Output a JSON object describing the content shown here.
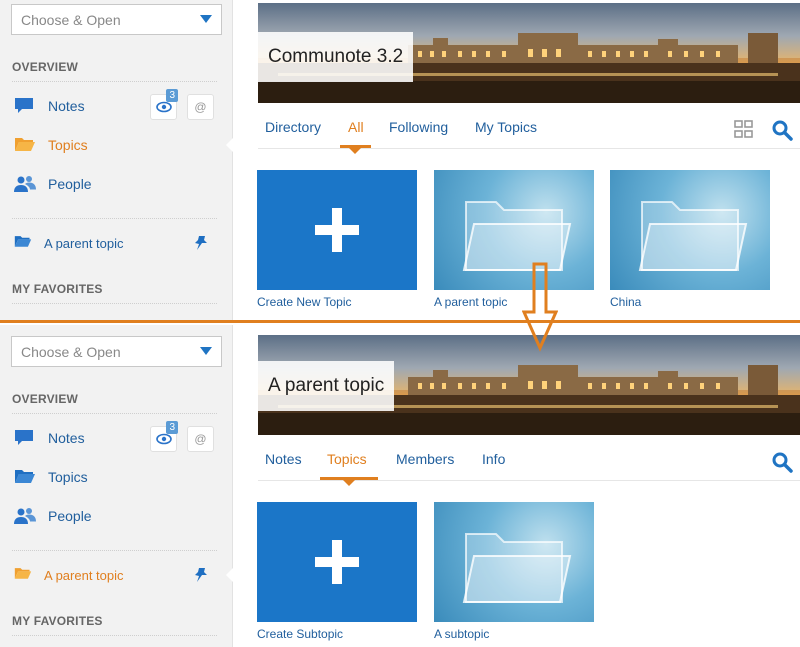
{
  "top": {
    "sidebar": {
      "dropdown_placeholder": "Choose & Open",
      "overview_title": "OVERVIEW",
      "items": [
        {
          "label": "Notes",
          "badge": "3",
          "icon": "speech-bubble-icon"
        },
        {
          "label": "Topics",
          "icon": "folder-open-icon"
        },
        {
          "label": "People",
          "icon": "people-icon"
        }
      ],
      "pinned": {
        "label": "A parent topic",
        "icon": "folder-open-icon"
      },
      "favorites_title": "MY FAVORITES"
    },
    "banner_title": "Communote 3.2",
    "tabs": [
      "Directory",
      "All",
      "Following",
      "My Topics"
    ],
    "active_tab": "All",
    "tiles": [
      {
        "label": "Create New Topic",
        "type": "create"
      },
      {
        "label": "A parent topic",
        "type": "folder"
      },
      {
        "label": "China",
        "type": "folder"
      }
    ]
  },
  "bottom": {
    "sidebar": {
      "dropdown_placeholder": "Choose & Open",
      "overview_title": "OVERVIEW",
      "items": [
        {
          "label": "Notes",
          "badge": "3",
          "icon": "speech-bubble-icon"
        },
        {
          "label": "Topics",
          "icon": "folder-open-icon"
        },
        {
          "label": "People",
          "icon": "people-icon"
        }
      ],
      "pinned": {
        "label": "A parent topic",
        "icon": "folder-open-icon"
      },
      "favorites_title": "MY FAVORITES"
    },
    "banner_title": "A parent topic",
    "tabs": [
      "Notes",
      "Topics",
      "Members",
      "Info"
    ],
    "active_tab": "Topics",
    "tiles": [
      {
        "label": "Create Subtopic",
        "type": "create"
      },
      {
        "label": "A subtopic",
        "type": "folder"
      }
    ]
  },
  "colors": {
    "accent": "#e07f1f",
    "link": "#215f9d",
    "tile_blue": "#1b76c8"
  }
}
